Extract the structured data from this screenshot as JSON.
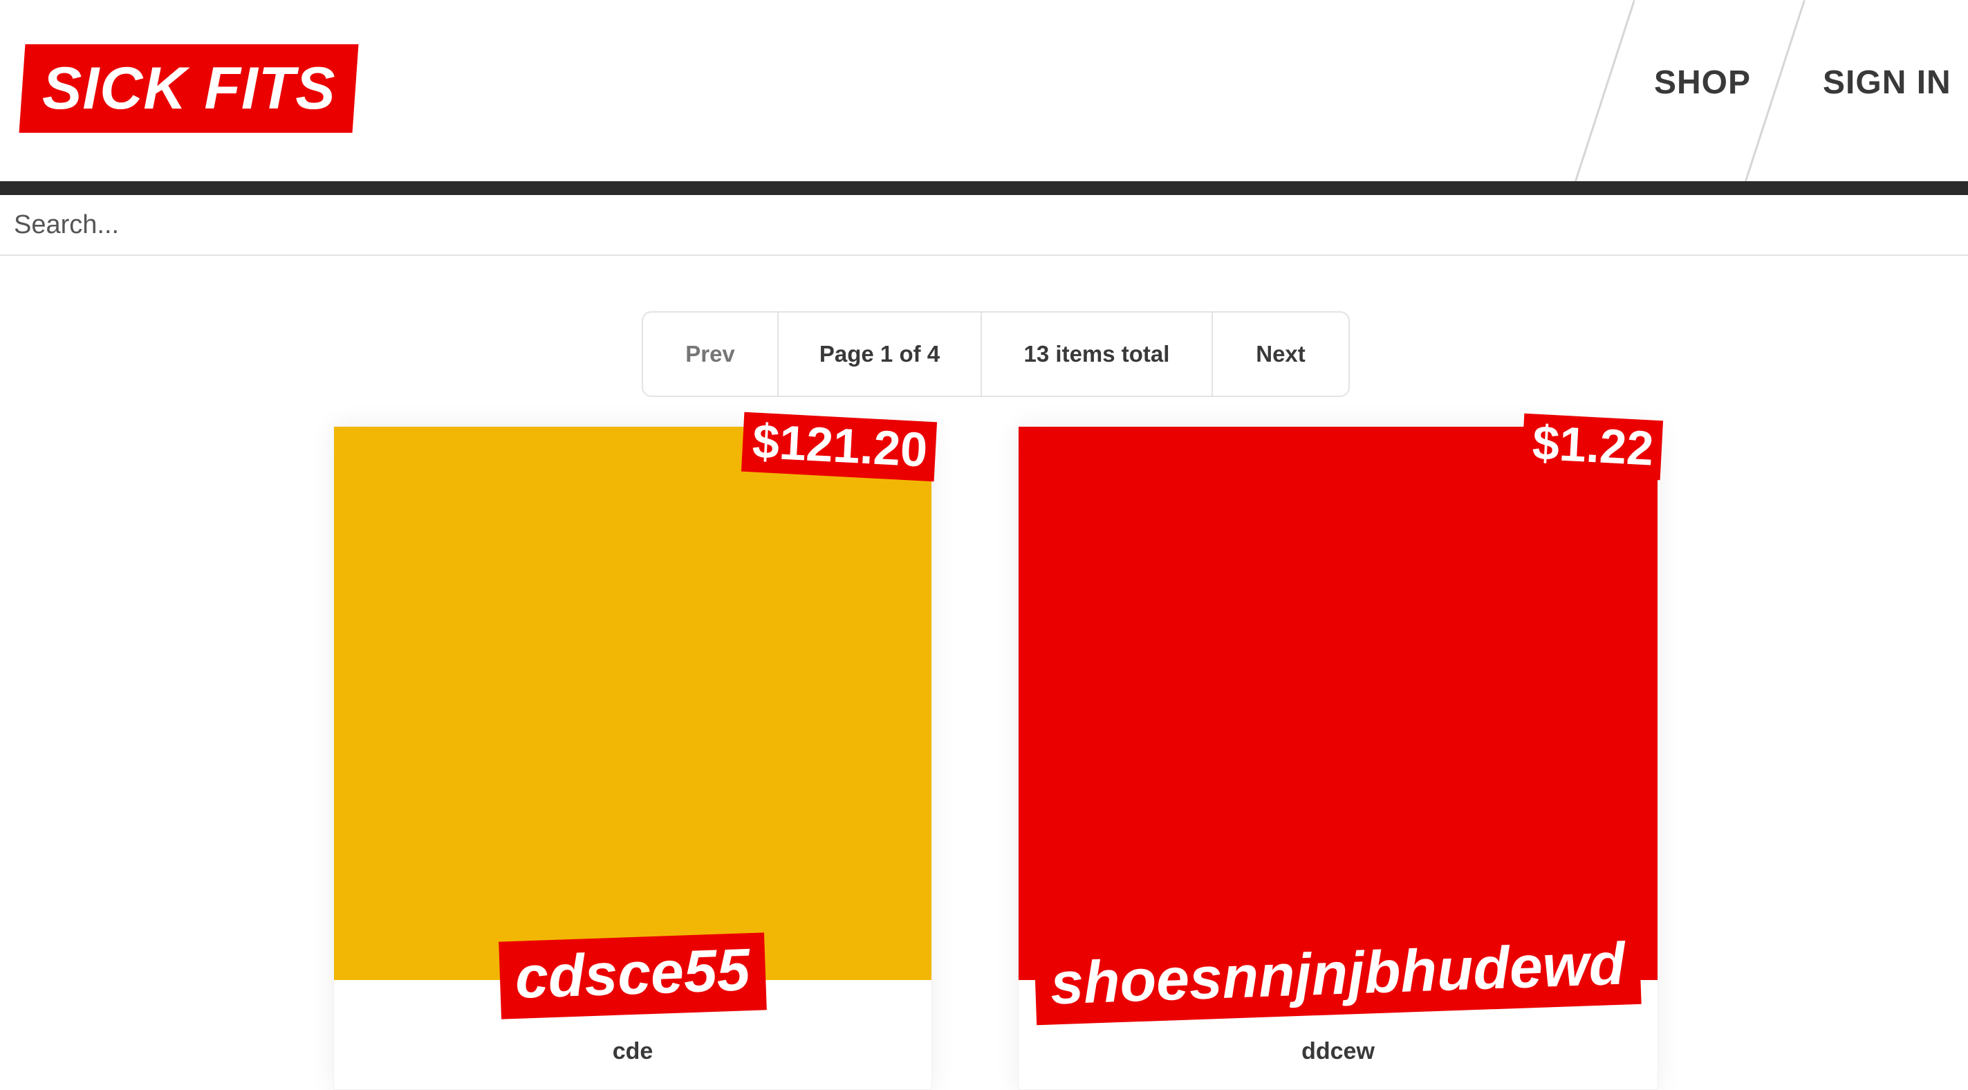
{
  "header": {
    "logo_text": "SICK FITS",
    "nav": [
      {
        "label": "SHOP"
      },
      {
        "label": "SIGN IN"
      }
    ]
  },
  "search": {
    "placeholder": "Search..."
  },
  "pagination": {
    "prev_label": "Prev",
    "page_label": "Page 1 of 4",
    "total_label": "13 items total",
    "next_label": "Next"
  },
  "products": [
    {
      "price": "$121.20",
      "title": "cdsce55",
      "description": "cde",
      "image_color": "#f2b705"
    },
    {
      "price": "$1.22",
      "title": "shoesnnjnjbhudewd",
      "description": "ddcew",
      "image_color": "#eb0000"
    }
  ],
  "colors": {
    "brand_red": "#eb0000",
    "header_bar": "#2b2b2b",
    "text": "#393939"
  }
}
